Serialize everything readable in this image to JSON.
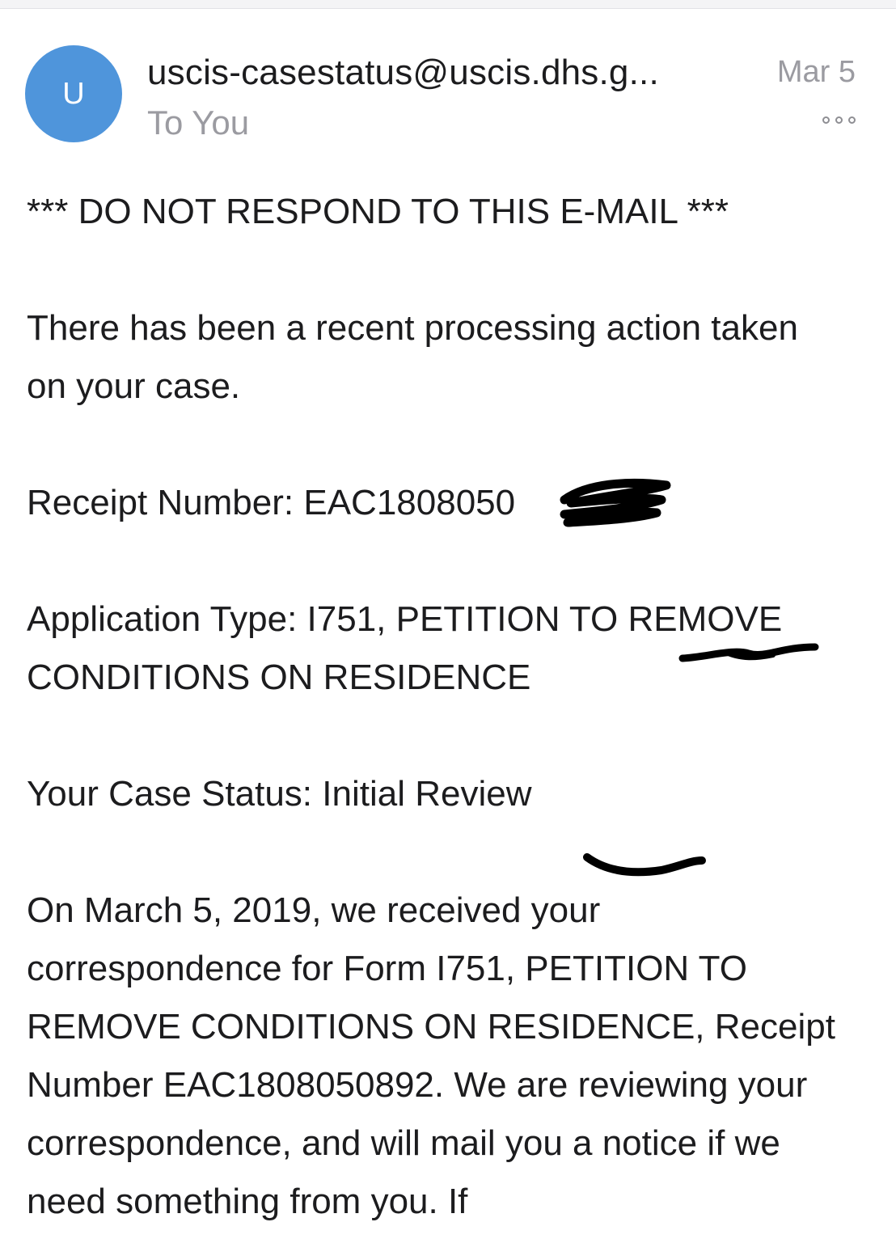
{
  "header": {
    "avatar_letter": "U",
    "sender": "uscis-casestatus@uscis.dhs.g...",
    "recipient": "To You",
    "date": "Mar 5",
    "more_icon": "ellipsis-icon"
  },
  "email": {
    "warning": "*** DO NOT RESPOND TO THIS E-MAIL ***",
    "intro": "There has been a recent processing action taken on your case.",
    "receipt_line": "Receipt Number: EAC1808050",
    "application_type": "Application Type: I751, PETITION TO REMOVE CONDITIONS ON RESIDENCE",
    "case_status": "Your Case Status: Initial Review",
    "details": "On March 5, 2019, we received your correspondence for Form I751, PETITION TO REMOVE CONDITIONS ON RESIDENCE, Receipt Number EAC1808050892. We are reviewing your correspondence, and will mail you a notice if we need something from you. If"
  },
  "colors": {
    "avatar": "#4f95db",
    "muted_text": "#9b9ba1",
    "body_text": "#1c1c1e",
    "scribble": "#000000"
  }
}
